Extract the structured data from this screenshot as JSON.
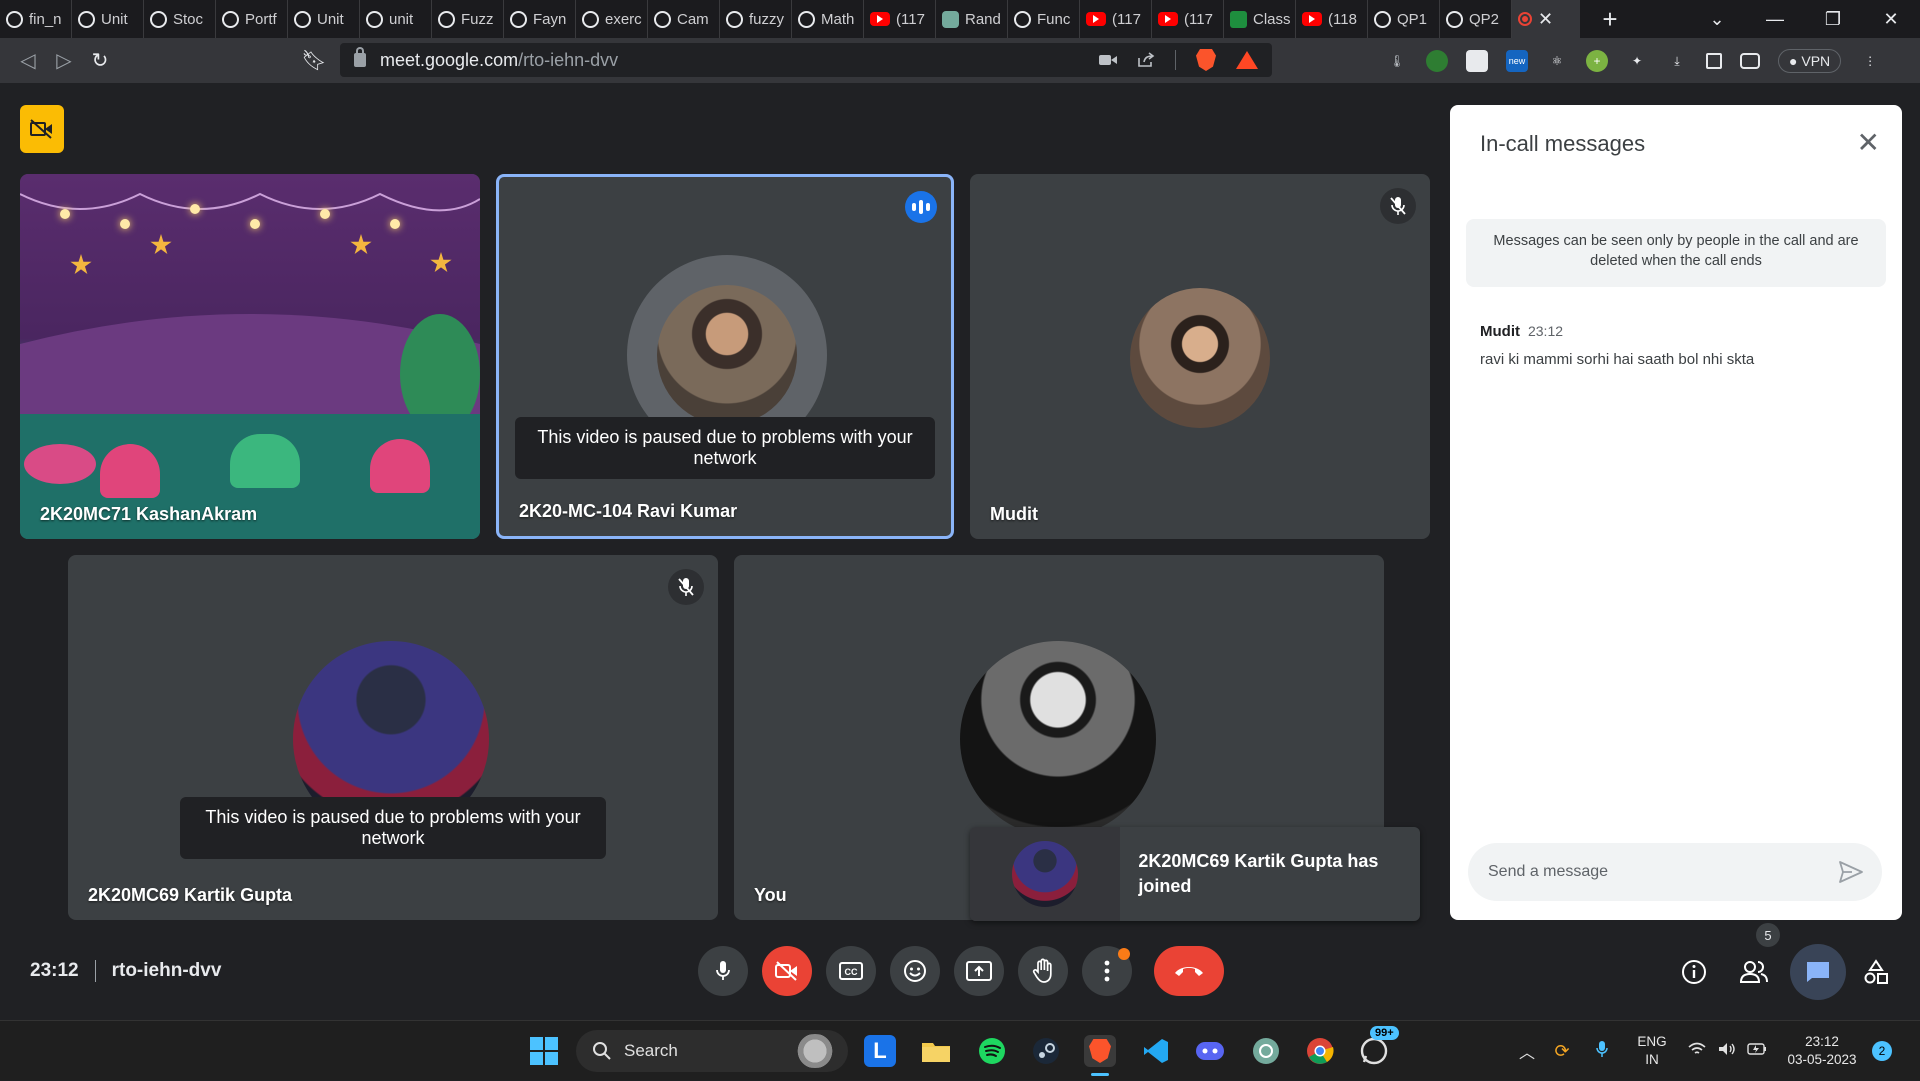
{
  "browser": {
    "tabs": [
      {
        "label": "fin_n",
        "icon": "globe"
      },
      {
        "label": "Unit",
        "icon": "globe"
      },
      {
        "label": "Stoc",
        "icon": "globe"
      },
      {
        "label": "Portf",
        "icon": "globe"
      },
      {
        "label": "Unit",
        "icon": "globe"
      },
      {
        "label": "unit",
        "icon": "globe"
      },
      {
        "label": "Fuzz",
        "icon": "globe"
      },
      {
        "label": "Fayn",
        "icon": "globe"
      },
      {
        "label": "exerc",
        "icon": "globe"
      },
      {
        "label": "Cam",
        "icon": "globe"
      },
      {
        "label": "fuzzy",
        "icon": "globe"
      },
      {
        "label": "Math",
        "icon": "globe"
      },
      {
        "label": "(117",
        "icon": "yt"
      },
      {
        "label": "Rand",
        "icon": "gpt"
      },
      {
        "label": "Func",
        "icon": "globe"
      },
      {
        "label": "(117",
        "icon": "yt"
      },
      {
        "label": "(117",
        "icon": "yt"
      },
      {
        "label": "Class",
        "icon": "cls"
      },
      {
        "label": "(118",
        "icon": "yt"
      },
      {
        "label": "QP1",
        "icon": "globe"
      },
      {
        "label": "QP2",
        "icon": "globe"
      }
    ],
    "url_host": "meet.google.com",
    "url_path": "/rto-iehn-dvv",
    "vpn_label": "VPN"
  },
  "meet": {
    "tiles": {
      "kashan": {
        "name": "2K20MC71 KashanAkram"
      },
      "ravi": {
        "name": "2K20-MC-104 Ravi Kumar",
        "paused": "This video is paused due to problems with your network"
      },
      "mudit": {
        "name": "Mudit"
      },
      "kartik": {
        "name": "2K20MC69 Kartik Gupta",
        "paused": "This video is paused due to problems with your network"
      },
      "you": {
        "name": "You"
      }
    },
    "toast": "2K20MC69 Kartik Gupta has joined",
    "time": "23:12",
    "meeting_code": "rto-iehn-dvv",
    "people_count": "5"
  },
  "chat": {
    "title": "In-call messages",
    "info": "Messages can be seen only by people in the call and are deleted when the call ends",
    "messages": [
      {
        "sender": "Mudit",
        "time": "23:12",
        "text": "ravi ki mammi sorhi hai saath bol nhi skta"
      }
    ],
    "placeholder": "Send a message"
  },
  "taskbar": {
    "search": "Search",
    "lang": "ENG",
    "region": "IN",
    "time": "23:12",
    "date": "03-05-2023",
    "notifications": "2",
    "whatsapp_badge": "99+"
  },
  "colors": {
    "accent_blue": "#1a73e8",
    "hangup_red": "#ea4335",
    "camoff_yellow": "#fbbc04",
    "bg": "#202124",
    "tile": "#3c4043"
  }
}
